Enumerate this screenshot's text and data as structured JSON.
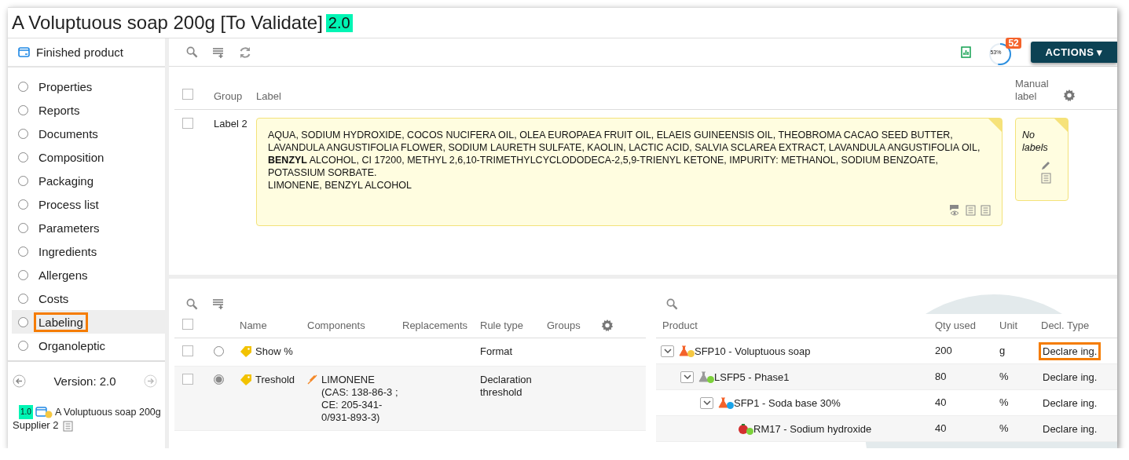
{
  "title": {
    "text": "A Voluptuous soap 200g [To Validate]",
    "version": "2.0"
  },
  "sidebar": {
    "header": "Finished product",
    "items": [
      {
        "label": "Properties",
        "selected": false,
        "highlighted": false
      },
      {
        "label": "Reports",
        "selected": false,
        "highlighted": false
      },
      {
        "label": "Documents",
        "selected": false,
        "highlighted": false
      },
      {
        "label": "Composition",
        "selected": false,
        "highlighted": false
      },
      {
        "label": "Packaging",
        "selected": false,
        "highlighted": false
      },
      {
        "label": "Process list",
        "selected": false,
        "highlighted": false
      },
      {
        "label": "Parameters",
        "selected": false,
        "highlighted": false
      },
      {
        "label": "Ingredients",
        "selected": false,
        "highlighted": false
      },
      {
        "label": "Allergens",
        "selected": false,
        "highlighted": false
      },
      {
        "label": "Costs",
        "selected": false,
        "highlighted": false
      },
      {
        "label": "Labeling",
        "selected": true,
        "highlighted": true
      },
      {
        "label": "Organoleptic",
        "selected": false,
        "highlighted": false
      }
    ],
    "version": "Version: 2.0",
    "footer": {
      "version": "1.0",
      "name": "A Voluptuous soap 200g",
      "supplier": "Supplier 2"
    }
  },
  "toolbar": {
    "progress": "53%",
    "level": 0.53,
    "badge": "52",
    "actions": "ACTIONS ▾"
  },
  "labels": {
    "checked": false,
    "columns": [
      "Group",
      "Label",
      "Manual label"
    ],
    "rows": [
      {
        "checked": false,
        "group": "Label 2",
        "label": [
          "AQUA, SODIUM HYDROXIDE, COCOS NUCIFERA OIL, OLEA EUROPAEA FRUIT OIL, ELAEIS GUINEENSIS OIL, THEOBROMA CACAO SEED BUTTER, LAVANDULA ANGUSTIFOLIA FLOWER, SODIUM LAURETH SULFATE, KAOLIN, LACTIC ACID, SALVIA SCLAREA EXTRACT, LAVANDULA ANGUSTIFOLIA OIL, **BENZYL** ALCOHOL, CI 17200, METHYL 2,6,10-TRIMETHYLCYCLODODECA-2,5,9-TRIENYL KETONE, IMPURITY: METHANOL, SODIUM BENZOATE, POTASSIUM SORBATE.",
          "LIMONENE, BENZYL ALCOHOL"
        ],
        "manual": "No labels"
      }
    ]
  },
  "rules": {
    "checked": false,
    "columns": [
      "Name",
      "Components",
      "Replacements",
      "Rule type",
      "Groups"
    ],
    "rows": [
      {
        "checked": false,
        "selected": false,
        "name": "Show %",
        "components": "",
        "rule_type": "Format"
      },
      {
        "checked": false,
        "selected": true,
        "name": "Treshold",
        "components": "LIMONENE (CAS: 138-86-3 ; CE: 205-341-0/931-893-3)",
        "rule_type": "Declaration threshold"
      }
    ]
  },
  "composition": {
    "columns": [
      "Product",
      "Qty used",
      "Unit",
      "Decl. Type"
    ],
    "rows": [
      {
        "kind": "product",
        "color": "#f5c842",
        "expanded": true,
        "name": "SFP10 - Voluptuous soap",
        "qty": "200",
        "unit": "g",
        "decl": "Declare ing.",
        "highlighted": true,
        "children": [
          {
            "kind": "semi-finished",
            "color": "#7dd13b",
            "expanded": true,
            "name": "LSFP5 - Phase1",
            "qty": "80",
            "unit": "%",
            "decl": "Declare ing.",
            "highlighted": false,
            "children": [
              {
                "kind": "product",
                "color": "#1aa3e8",
                "expanded": true,
                "name": "SFP1 - Soda base 30%",
                "qty": "40",
                "unit": "%",
                "decl": "Declare ing.",
                "highlighted": false,
                "children": [
                  {
                    "kind": "raw-material",
                    "color": "#7dd13b",
                    "name": "RM17 - Sodium hydroxide",
                    "qty": "40",
                    "unit": "%",
                    "decl": "Declare ing.",
                    "highlighted": false
                  }
                ]
              }
            ]
          }
        ]
      }
    ]
  }
}
